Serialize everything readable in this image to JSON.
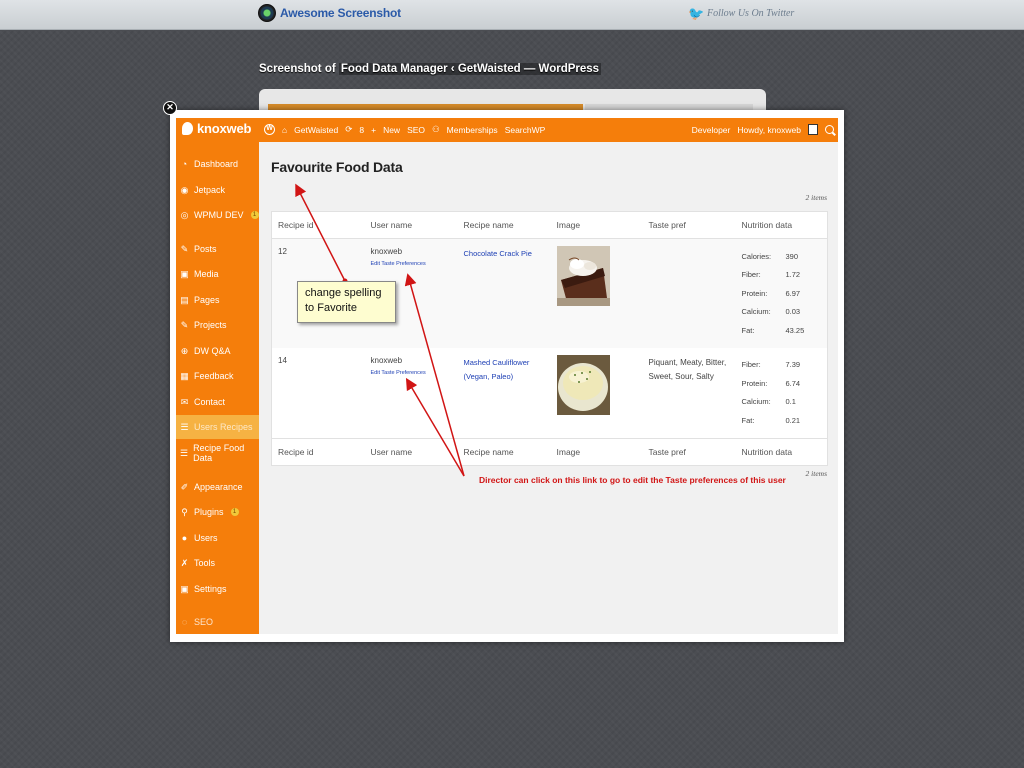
{
  "viewer": {
    "brand": "Awesome Screenshot",
    "twitter": "Follow Us On Twitter",
    "shot_prefix": "Screenshot of",
    "shot_title": "Food Data Manager ‹ GetWaisted — WordPress"
  },
  "adminbar": {
    "site_logo_text": "knoxweb",
    "site_name": "GetWaisted",
    "updates": "8",
    "new_label": "New",
    "seo": "SEO",
    "memberships": "Memberships",
    "searchwp": "SearchWP",
    "developer": "Developer",
    "howdy": "Howdy, knoxweb"
  },
  "sidebar": {
    "items": [
      {
        "label": "Dashboard",
        "icon": "dashboard-icon"
      },
      {
        "label": "Jetpack",
        "icon": "jetpack-icon"
      },
      {
        "label": "WPMU DEV",
        "icon": "wpmudev-icon",
        "badge": "1"
      },
      {
        "label": "Posts",
        "icon": "pin-icon"
      },
      {
        "label": "Media",
        "icon": "media-icon"
      },
      {
        "label": "Pages",
        "icon": "pages-icon"
      },
      {
        "label": "Projects",
        "icon": "pin-icon"
      },
      {
        "label": "DW Q&A",
        "icon": "lifebuoy-icon"
      },
      {
        "label": "Feedback",
        "icon": "feedback-icon"
      },
      {
        "label": "Contact",
        "icon": "mail-icon"
      },
      {
        "label": "Users Recipes",
        "icon": "list-icon",
        "active": true
      },
      {
        "label": "Recipe Food Data",
        "icon": "list-icon"
      },
      {
        "label": "Appearance",
        "icon": "brush-icon"
      },
      {
        "label": "Plugins",
        "icon": "plug-icon",
        "badge": "1"
      },
      {
        "label": "Users",
        "icon": "user-icon"
      },
      {
        "label": "Tools",
        "icon": "wrench-icon"
      },
      {
        "label": "Settings",
        "icon": "settings-icon"
      },
      {
        "label": "SEO",
        "icon": "seo-icon"
      }
    ]
  },
  "page": {
    "title": "Favourite Food Data",
    "items_count": "2 items",
    "columns": [
      "Recipe id",
      "User name",
      "Recipe name",
      "Image",
      "Taste pref",
      "Nutrition data"
    ],
    "rows": [
      {
        "recipe_id": "12",
        "user": "knoxweb",
        "edit_link": "Edit Taste Preferences",
        "recipe_name": "Chocolate Crack Pie",
        "taste_pref": "",
        "nutrition": [
          {
            "label": "Calories:",
            "value": "390"
          },
          {
            "label": "Fiber:",
            "value": "1.72"
          },
          {
            "label": "Protein:",
            "value": "6.97"
          },
          {
            "label": "Calcium:",
            "value": "0.03"
          },
          {
            "label": "Fat:",
            "value": "43.25"
          }
        ]
      },
      {
        "recipe_id": "14",
        "user": "knoxweb",
        "edit_link": "Edit Taste Preferences",
        "recipe_name": "Mashed Cauliflower (Vegan, Paleo)",
        "taste_pref": "Piquant, Meaty, Bitter, Sweet, Sour, Salty",
        "nutrition": [
          {
            "label": "Fiber:",
            "value": "7.39"
          },
          {
            "label": "Protein:",
            "value": "6.74"
          },
          {
            "label": "Calcium:",
            "value": "0.1"
          },
          {
            "label": "Fat:",
            "value": "0.21"
          }
        ]
      }
    ]
  },
  "annotations": {
    "note": "change spelling to Favorite",
    "red_note": "Director can click on this link to go to edit the Taste preferences of this user"
  },
  "colors": {
    "admin_orange": "#f57e0b",
    "annotation_red": "#d11515"
  }
}
